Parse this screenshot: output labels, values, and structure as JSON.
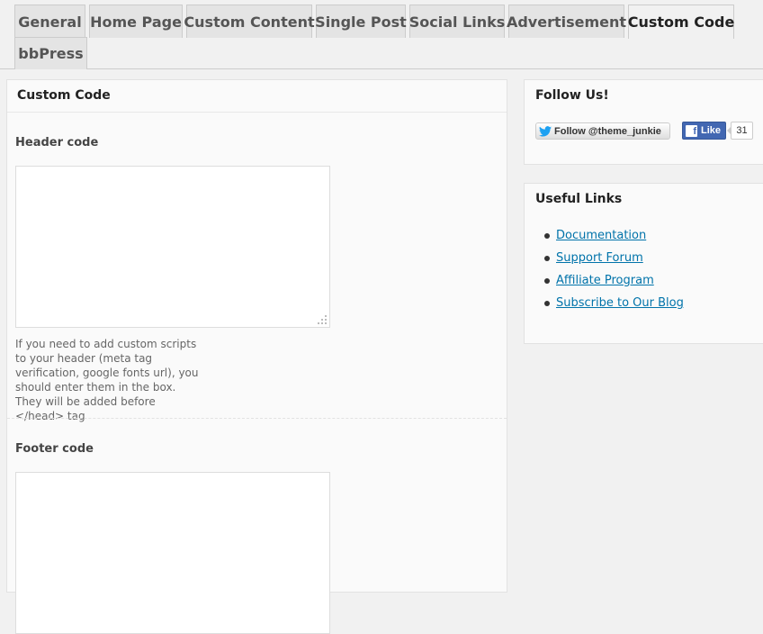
{
  "tabs": [
    {
      "label": "General",
      "active": false
    },
    {
      "label": "Home Page",
      "active": false
    },
    {
      "label": "Custom Content",
      "active": false
    },
    {
      "label": "Single Post",
      "active": false
    },
    {
      "label": "Social Links",
      "active": false
    },
    {
      "label": "Advertisement",
      "active": false
    },
    {
      "label": "Custom Code",
      "active": true
    },
    {
      "label": "bbPress",
      "active": false
    }
  ],
  "main": {
    "title": "Custom Code",
    "header_code": {
      "label": "Header code",
      "value": "",
      "help": "If you need to add custom scripts to your header (meta tag verification, google fonts url), you should enter them in the box. They will be added before </head> tag"
    },
    "footer_code": {
      "label": "Footer code",
      "value": ""
    }
  },
  "follow": {
    "title": "Follow Us!",
    "twitter_label": "Follow @theme_junkie",
    "facebook_label": "Like",
    "facebook_count": "31"
  },
  "useful_links": {
    "title": "Useful Links",
    "items": [
      "Documentation",
      "Support Forum",
      "Affiliate Program",
      "Subscribe to Our Blog"
    ]
  },
  "colors": {
    "link": "#0073aa",
    "facebook": "#4267b2"
  }
}
